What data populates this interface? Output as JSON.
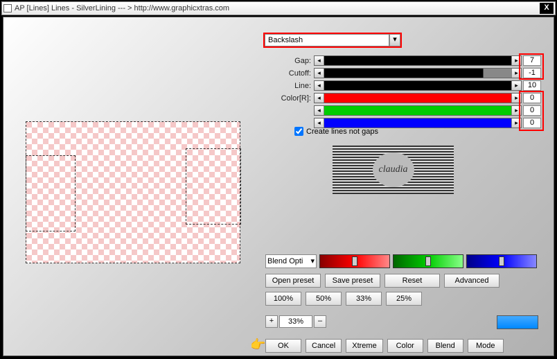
{
  "window": {
    "title": "AP [Lines]  Lines - SilverLining   --- > http://www.graphicxtras.com",
    "close": "X"
  },
  "dropdown": {
    "value": "Backslash",
    "arrow": "▾"
  },
  "params": {
    "rows": [
      {
        "label": "Gap:",
        "val": "7",
        "track": "black"
      },
      {
        "label": "Cutoff:",
        "val": "-1",
        "track": "gray"
      },
      {
        "label": "Line:",
        "val": "10",
        "track": "black"
      },
      {
        "label": "Color[R]:",
        "val": "0",
        "track": "red"
      },
      {
        "label": "",
        "val": "0",
        "track": "green"
      },
      {
        "label": "",
        "val": "0",
        "track": "blue"
      }
    ],
    "arrL": "◂",
    "arrR": "▸"
  },
  "checkbox": {
    "label": "Create lines not gaps"
  },
  "logo": {
    "text": "claudia"
  },
  "blend": {
    "select": "Blend Opti",
    "arrow": "▾"
  },
  "buttons": {
    "open": "Open preset",
    "save": "Save preset",
    "reset": "Reset",
    "adv": "Advanced",
    "p100": "100%",
    "p50": "50%",
    "p33": "33%",
    "p25": "25%",
    "plus": "+",
    "minus": "–",
    "pct": "33%",
    "ok": "OK",
    "cancel": "Cancel",
    "xtreme": "Xtreme",
    "color": "Color",
    "blendb": "Blend",
    "mode": "Mode"
  },
  "hand": "☜"
}
